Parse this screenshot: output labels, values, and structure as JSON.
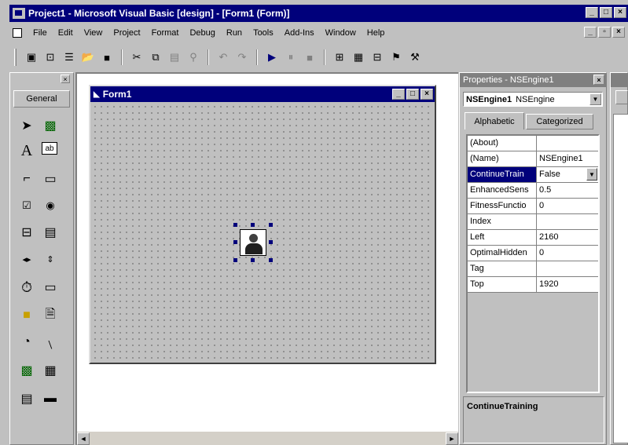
{
  "window": {
    "title": "Project1 - Microsoft Visual Basic [design] - [Form1 (Form)]",
    "minimize": "_",
    "maximize": "□",
    "close": "×"
  },
  "menu": {
    "items": [
      "File",
      "Edit",
      "View",
      "Project",
      "Format",
      "Debug",
      "Run",
      "Tools",
      "Add-Ins",
      "Window",
      "Help"
    ],
    "mdi_minimize": "_",
    "mdi_restore": "▫",
    "mdi_close": "×"
  },
  "toolbox": {
    "tab_label": "General",
    "close": "×"
  },
  "form": {
    "title": "Form1",
    "minimize": "_",
    "maximize": "□",
    "close": "×"
  },
  "scroll": {
    "left": "◄",
    "right": "►"
  },
  "properties": {
    "title": "Properties - NSEngine1",
    "close": "×",
    "object_name": "NSEngine1",
    "object_type": "NSEngine",
    "tabs": [
      "Alphabetic",
      "Categorized"
    ],
    "rows": [
      {
        "name": "(About)",
        "value": ""
      },
      {
        "name": "(Name)",
        "value": "NSEngine1"
      },
      {
        "name": "ContinueTrain",
        "value": "False"
      },
      {
        "name": "EnhancedSens",
        "value": "0.5"
      },
      {
        "name": "FitnessFunctio",
        "value": "0"
      },
      {
        "name": "Index",
        "value": ""
      },
      {
        "name": "Left",
        "value": "2160"
      },
      {
        "name": "OptimalHidden",
        "value": "0"
      },
      {
        "name": "Tag",
        "value": ""
      },
      {
        "name": "Top",
        "value": "1920"
      }
    ],
    "description": "ContinueTraining"
  }
}
